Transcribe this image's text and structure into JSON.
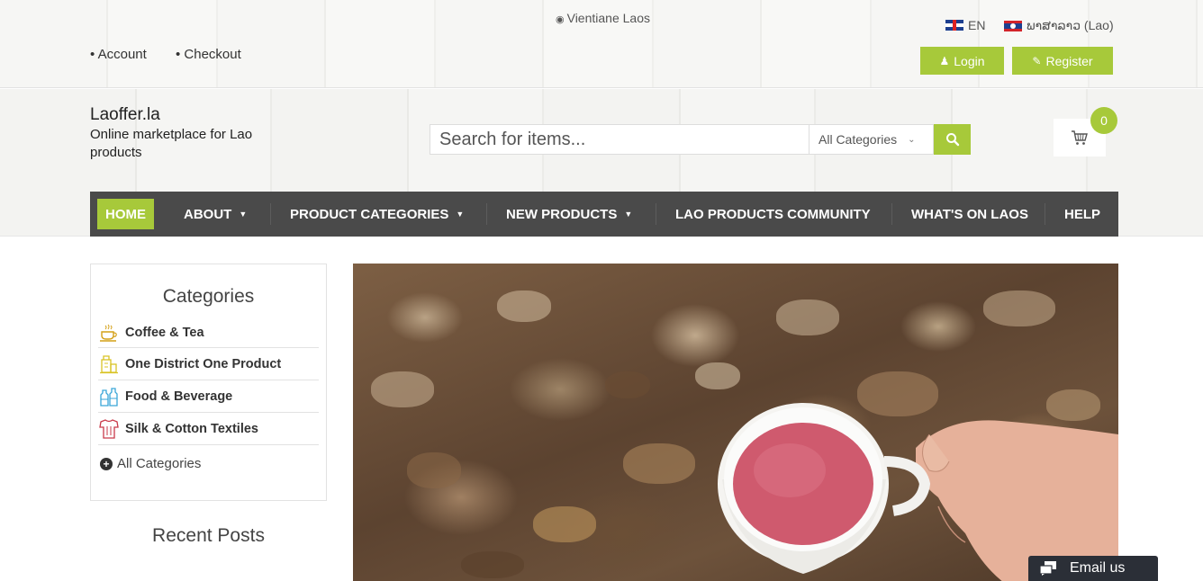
{
  "topbar": {
    "location": "Vientiane Laos",
    "account_links": [
      "Account",
      "Checkout"
    ],
    "languages": [
      {
        "label": "EN"
      },
      {
        "label": "ພາສາລາວ (Lao)"
      }
    ],
    "login_label": "Login",
    "register_label": "Register"
  },
  "brand": {
    "name": "Laoffer.la",
    "tagline": "Online marketplace for Lao products"
  },
  "search": {
    "placeholder": "Search for items...",
    "category_selected": "All Categories"
  },
  "cart": {
    "count": "0"
  },
  "nav": {
    "items": [
      {
        "label": "HOME",
        "active": true
      },
      {
        "label": "ABOUT",
        "dropdown": true
      },
      {
        "label": "PRODUCT CATEGORIES",
        "dropdown": true
      },
      {
        "label": "NEW PRODUCTS",
        "dropdown": true
      },
      {
        "label": "LAO PRODUCTS COMMUNITY"
      },
      {
        "label": "WHAT'S ON LAOS"
      },
      {
        "label": "HELP"
      }
    ]
  },
  "sidebar": {
    "title": "Categories",
    "categories": [
      {
        "label": "Coffee & Tea",
        "icon": "coffee-cup-icon"
      },
      {
        "label": "One District One Product",
        "icon": "building-icon"
      },
      {
        "label": "Food & Beverage",
        "icon": "bottles-icon"
      },
      {
        "label": "Silk & Cotton Textiles",
        "icon": "textile-icon"
      }
    ],
    "all_label": "All Categories",
    "recent_title": "Recent Posts"
  },
  "widget": {
    "email_label": "Email us"
  },
  "colors": {
    "accent": "#a7c93a",
    "nav_bg": "#4a4a4a",
    "text": "#333333"
  }
}
